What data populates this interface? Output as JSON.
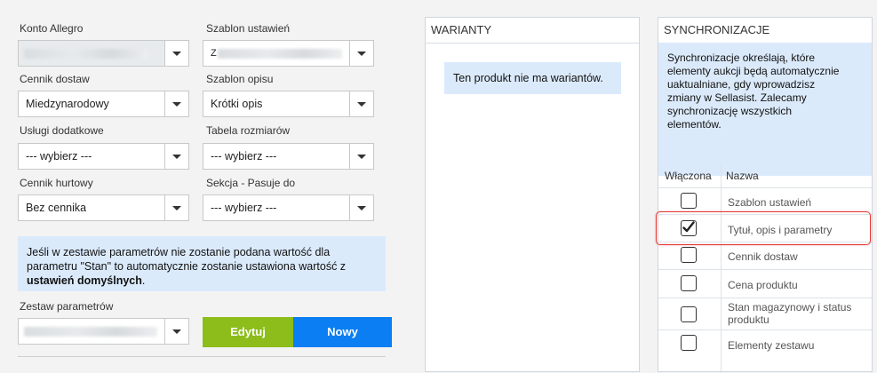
{
  "form": {
    "konto": {
      "label": "Konto Allegro"
    },
    "szablon_ustawien": {
      "label": "Szablon ustawień",
      "value_prefix": "Z"
    },
    "cennik_dostaw": {
      "label": "Cennik dostaw",
      "value": "Miedzynarodowy"
    },
    "szablon_opisu": {
      "label": "Szablon opisu",
      "value": "Krótki opis"
    },
    "uslugi": {
      "label": "Usługi dodatkowe",
      "value": "--- wybierz ---"
    },
    "tabela": {
      "label": "Tabela rozmiarów",
      "value": "--- wybierz ---"
    },
    "cennik_hurtowy": {
      "label": "Cennik hurtowy",
      "value": "Bez cennika"
    },
    "sekcja": {
      "label": "Sekcja - Pasuje do",
      "value": "--- wybierz ---"
    },
    "info_line1": "Jeśli w zestawie parametrów nie zostanie podana wartość dla",
    "info_line2": "parametru \"Stan\" to automatycznie zostanie ustawiona wartość z",
    "info_bold": "ustawień domyślnych",
    "info_end": ".",
    "zestaw": {
      "label": "Zestaw parametrów"
    },
    "edit_button": "Edytuj",
    "new_button": "Nowy"
  },
  "warianty": {
    "title": "WARIANTY",
    "message": "Ten produkt nie ma wariantów."
  },
  "sync": {
    "title": "SYNCHRONIZACJE",
    "desc": [
      "Synchronizacje określają, które",
      "elementy aukcji będą automatycznie",
      "uaktualniane, gdy wprowadzisz",
      "zmiany w Sellasist. Zalecamy",
      "synchronizację wszystkich",
      "elementów."
    ],
    "col_enabled": "Włączona",
    "col_name": "Nazwa",
    "rows": [
      {
        "name": "Szablon ustawień",
        "checked": false
      },
      {
        "name": "Tytuł, opis i parametry",
        "checked": true
      },
      {
        "name": "Cennik dostaw",
        "checked": false
      },
      {
        "name": "Cena produktu",
        "checked": false
      },
      {
        "name_line1": "Stan magazynowy i status",
        "name_line2": "produktu",
        "checked": false
      },
      {
        "name": "Elementy zestawu",
        "checked": false
      }
    ]
  },
  "colors": {
    "edit": "#8cbd1a",
    "new": "#0a7ef2",
    "info_bg": "#dbeafb",
    "highlight": "#e53935"
  }
}
